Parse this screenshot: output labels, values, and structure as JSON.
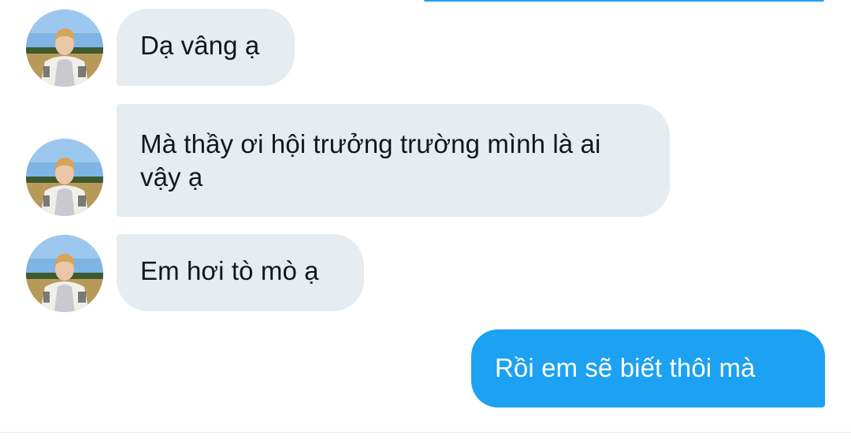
{
  "conversation": {
    "messages": [
      {
        "sender": "other",
        "text": "Dạ vâng ạ"
      },
      {
        "sender": "other",
        "text": "Mà thầy ơi hội trưởng trường mình là ai vậy ạ"
      },
      {
        "sender": "other",
        "text": "Em hơi tò mò ạ"
      },
      {
        "sender": "me",
        "text": "Rồi em sẽ biết thôi mà"
      }
    ]
  },
  "colors": {
    "incoming_bubble": "#E6ECF0",
    "outgoing_bubble": "#1DA1F2",
    "incoming_text": "#14171A",
    "outgoing_text": "#FFFFFF"
  }
}
